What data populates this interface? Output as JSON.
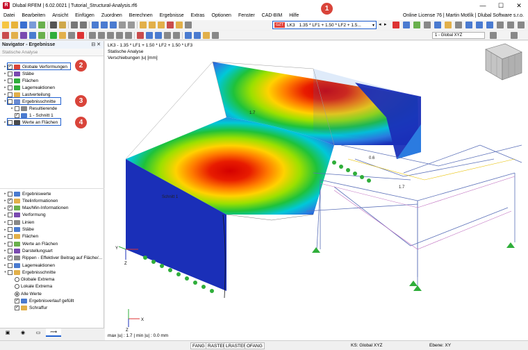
{
  "window": {
    "title": "Dlubal RFEM | 6.02.0021 | Tutorial_Structural-Analysis.rf6",
    "minimize": "—",
    "maximize": "☐",
    "close": "✕"
  },
  "menu": {
    "items": [
      "Datei",
      "Bearbeiten",
      "Ansicht",
      "Einfügen",
      "Zuordnen",
      "Berechnen",
      "Ergebnisse",
      "Extras",
      "Optionen",
      "Fenster",
      "CAD-BIM",
      "Hilfe"
    ],
    "license": "Online License 76 | Martin Motlík | Dlubal Software s.r.o."
  },
  "toolbar": {
    "load_combination": {
      "badge": "GZT",
      "code": "LK3",
      "text": "1.35 * LF1 + 1.50 * LF2 + 1.5..."
    },
    "coordinate_system": "1 - Global XYZ"
  },
  "navigator": {
    "title": "Navigator - Ergebnisse",
    "subtitle": "Statische Analyse",
    "tree": [
      {
        "label": "Globale Verformungen",
        "checked": true,
        "expander": "▸",
        "icon": "deformation-icon"
      },
      {
        "label": "Stäbe",
        "checked": false,
        "expander": "▸",
        "icon": "members-icon"
      },
      {
        "label": "Flächen",
        "checked": false,
        "expander": "▸",
        "icon": "surfaces-icon"
      },
      {
        "label": "Lagerreaktionen",
        "checked": false,
        "expander": "▸",
        "icon": "support-reactions-icon"
      },
      {
        "label": "Lastverteilung",
        "checked": false,
        "expander": "▸",
        "icon": "load-distribution-icon"
      },
      {
        "label": "Ergebnisschnitte",
        "checked": false,
        "expander": "▾",
        "icon": "result-sections-icon"
      },
      {
        "label": "Resultierende",
        "checked": false,
        "expander": "▸",
        "icon": "resultant-icon"
      },
      {
        "label": "1 - Schnitt 1",
        "checked": true,
        "expander": "",
        "icon": "section-icon"
      },
      {
        "label": "Werte an Flächen",
        "checked": false,
        "expander": "▸",
        "icon": "values-on-surfaces-icon"
      }
    ],
    "display": [
      {
        "label": "Ergebniswerte",
        "checked": false,
        "expander": "▸",
        "type": "check"
      },
      {
        "label": "Titelinformationen",
        "checked": true,
        "expander": "▸",
        "type": "check"
      },
      {
        "label": "Max/Min-Informationen",
        "checked": true,
        "expander": "▸",
        "type": "check"
      },
      {
        "label": "Verformung",
        "checked": false,
        "expander": "▸",
        "type": "check"
      },
      {
        "label": "Linien",
        "checked": false,
        "expander": "▸",
        "type": "check"
      },
      {
        "label": "Stäbe",
        "checked": false,
        "expander": "▸",
        "type": "check"
      },
      {
        "label": "Flächen",
        "checked": false,
        "expander": "▸",
        "type": "check"
      },
      {
        "label": "Werte an Flächen",
        "checked": false,
        "expander": "▸",
        "type": "check"
      },
      {
        "label": "Darstellungsart",
        "checked": false,
        "expander": "▸",
        "type": "check"
      },
      {
        "label": "Rippen - Effektiver Beitrag auf Fläche/...",
        "checked": true,
        "expander": "▸",
        "type": "check"
      },
      {
        "label": "Lagerreaktionen",
        "checked": false,
        "expander": "▸",
        "type": "check"
      },
      {
        "label": "Ergebnisschnitte",
        "checked": false,
        "expander": "▾",
        "type": "check"
      },
      {
        "label": "Globale Extrema",
        "checked": false,
        "expander": "",
        "type": "radio"
      },
      {
        "label": "Lokale Extrema",
        "checked": false,
        "expander": "",
        "type": "radio"
      },
      {
        "label": "Alle Werte",
        "checked": true,
        "expander": "",
        "type": "radio"
      },
      {
        "label": "Ergebnisverlauf gefüllt",
        "checked": true,
        "expander": "",
        "type": "check"
      },
      {
        "label": "Schraffur",
        "checked": true,
        "expander": "",
        "type": "check"
      }
    ],
    "markers": [
      "2",
      "3",
      "4"
    ]
  },
  "viewport": {
    "info_line1": "LK3 - 1.35 * LF1 + 1.50 * LF2 + 1.50 * LF3",
    "info_line2": "Statische Analyse",
    "info_line3": "Verschiebungen |u| [mm]",
    "footer": "max |u| : 1.7 | min |u| : 0.0 mm",
    "labels": {
      "max_roof": "1.7",
      "frame_a": "0.6",
      "frame_b": "1.7",
      "section_name": "Schnitt 1",
      "axis_x": "X",
      "axis_y": "Y",
      "axis_z": "Z"
    }
  },
  "top_marker": "1",
  "statusbar": {
    "toggles": [
      "FANG",
      "RASTER",
      "LRASTER",
      "OFANG"
    ],
    "cs": "KS: Global XYZ",
    "plane": "Ebene: XY"
  },
  "colors": {
    "highlight": "#1f5fd0",
    "marker": "#d9443a",
    "support": "#2fae3a"
  }
}
